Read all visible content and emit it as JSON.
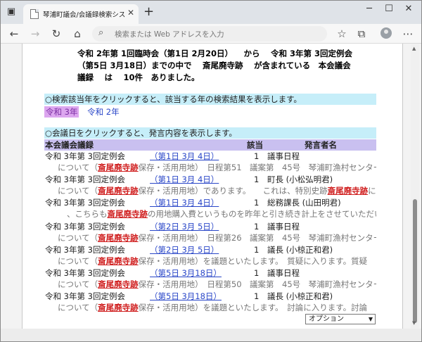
{
  "browser": {
    "tab_title": "琴浦町議会/会議録検索システム",
    "address_placeholder": "検索または Web アドレスを入力",
    "new_tab_symbol": "+",
    "close_symbol": "✕"
  },
  "summary": {
    "line1": "令和 2年第 1回臨時会（第1日 2月20日） 　から　 令和 3年第 3回定例会",
    "line2": "（第5日 3月18日）までの中で　 斎尾廃寺跡 　が含まれている　本会議会",
    "line3": "議録　 は　 10件　ありました。"
  },
  "year_section": {
    "instruction": "○検索該当年をクリックすると、該当する年の検索結果を表示します。",
    "selected_year": "令和 3年",
    "other_year": "令和 2年"
  },
  "meeting_section": {
    "instruction": "○会議日をクリックすると、発言内容を表示します。",
    "col_title": "本会議会議録",
    "col_item": "該当",
    "col_speaker": "発言者名"
  },
  "results": [
    {
      "meeting": "令和 3年第 3回定例会",
      "date": "（第1日 3月 4日）",
      "count": "1",
      "speaker": "議事日程",
      "snippet_pre": "について（",
      "keyword": "斎尾廃寺跡",
      "snippet_post": "保存・活用用地）　日程第51　議案第　45号　琴浦町漁村センター"
    },
    {
      "meeting": "令和 3年第 3回定例会",
      "date": "（第1日 3月 4日）",
      "count": "1",
      "speaker": "町長 (小松弘明君)",
      "snippet_pre": "について（",
      "keyword": "斎尾廃寺跡",
      "snippet_post": "保存・活用用地）であります。　　これは、特別史跡",
      "keyword2": "斎尾廃寺跡",
      "snippet_post2": "に"
    },
    {
      "meeting": "令和 3年第 3回定例会",
      "date": "（第1日 3月 4日）",
      "count": "1",
      "speaker": "総務課長 (山田明君)",
      "snippet_pre": "、こちらも",
      "keyword": "斎尾廃寺跡",
      "snippet_post": "の用地購入費というものを昨年と引き続き計上をさせていただいて"
    },
    {
      "meeting": "令和 3年第 3回定例会",
      "date": "（第2日 3月 5日）",
      "count": "1",
      "speaker": "議事日程",
      "snippet_pre": "について（",
      "keyword": "斎尾廃寺跡",
      "snippet_post": "保存・活用用地）　日程第26　議案第　45号　琴浦町漁村センター"
    },
    {
      "meeting": "令和 3年第 3回定例会",
      "date": "（第2日 3月 5日）",
      "count": "1",
      "speaker": "議長 (小椋正和君)",
      "snippet_pre": "について（",
      "keyword": "斎尾廃寺跡",
      "snippet_post": "保存・活用用地）を議題といたします。　質疑に入ります。質疑"
    },
    {
      "meeting": "令和 3年第 3回定例会",
      "date": "（第5日 3月18日）",
      "count": "1",
      "speaker": "議事日程",
      "snippet_pre": "について（",
      "keyword": "斎尾廃寺跡",
      "snippet_post": "保存・活用用地）　日程第50　議案第　45号　琴浦町漁村センター"
    },
    {
      "meeting": "令和 3年第 3回定例会",
      "date": "（第5日 3月18日）",
      "count": "1",
      "speaker": "議長 (小椋正和君)",
      "snippet_pre": "について（",
      "keyword": "斎尾廃寺跡",
      "snippet_post": "保存・活用用地）を議題といたします。　討論に入ります。討論"
    }
  ],
  "options_select": {
    "selected": "オプション"
  }
}
